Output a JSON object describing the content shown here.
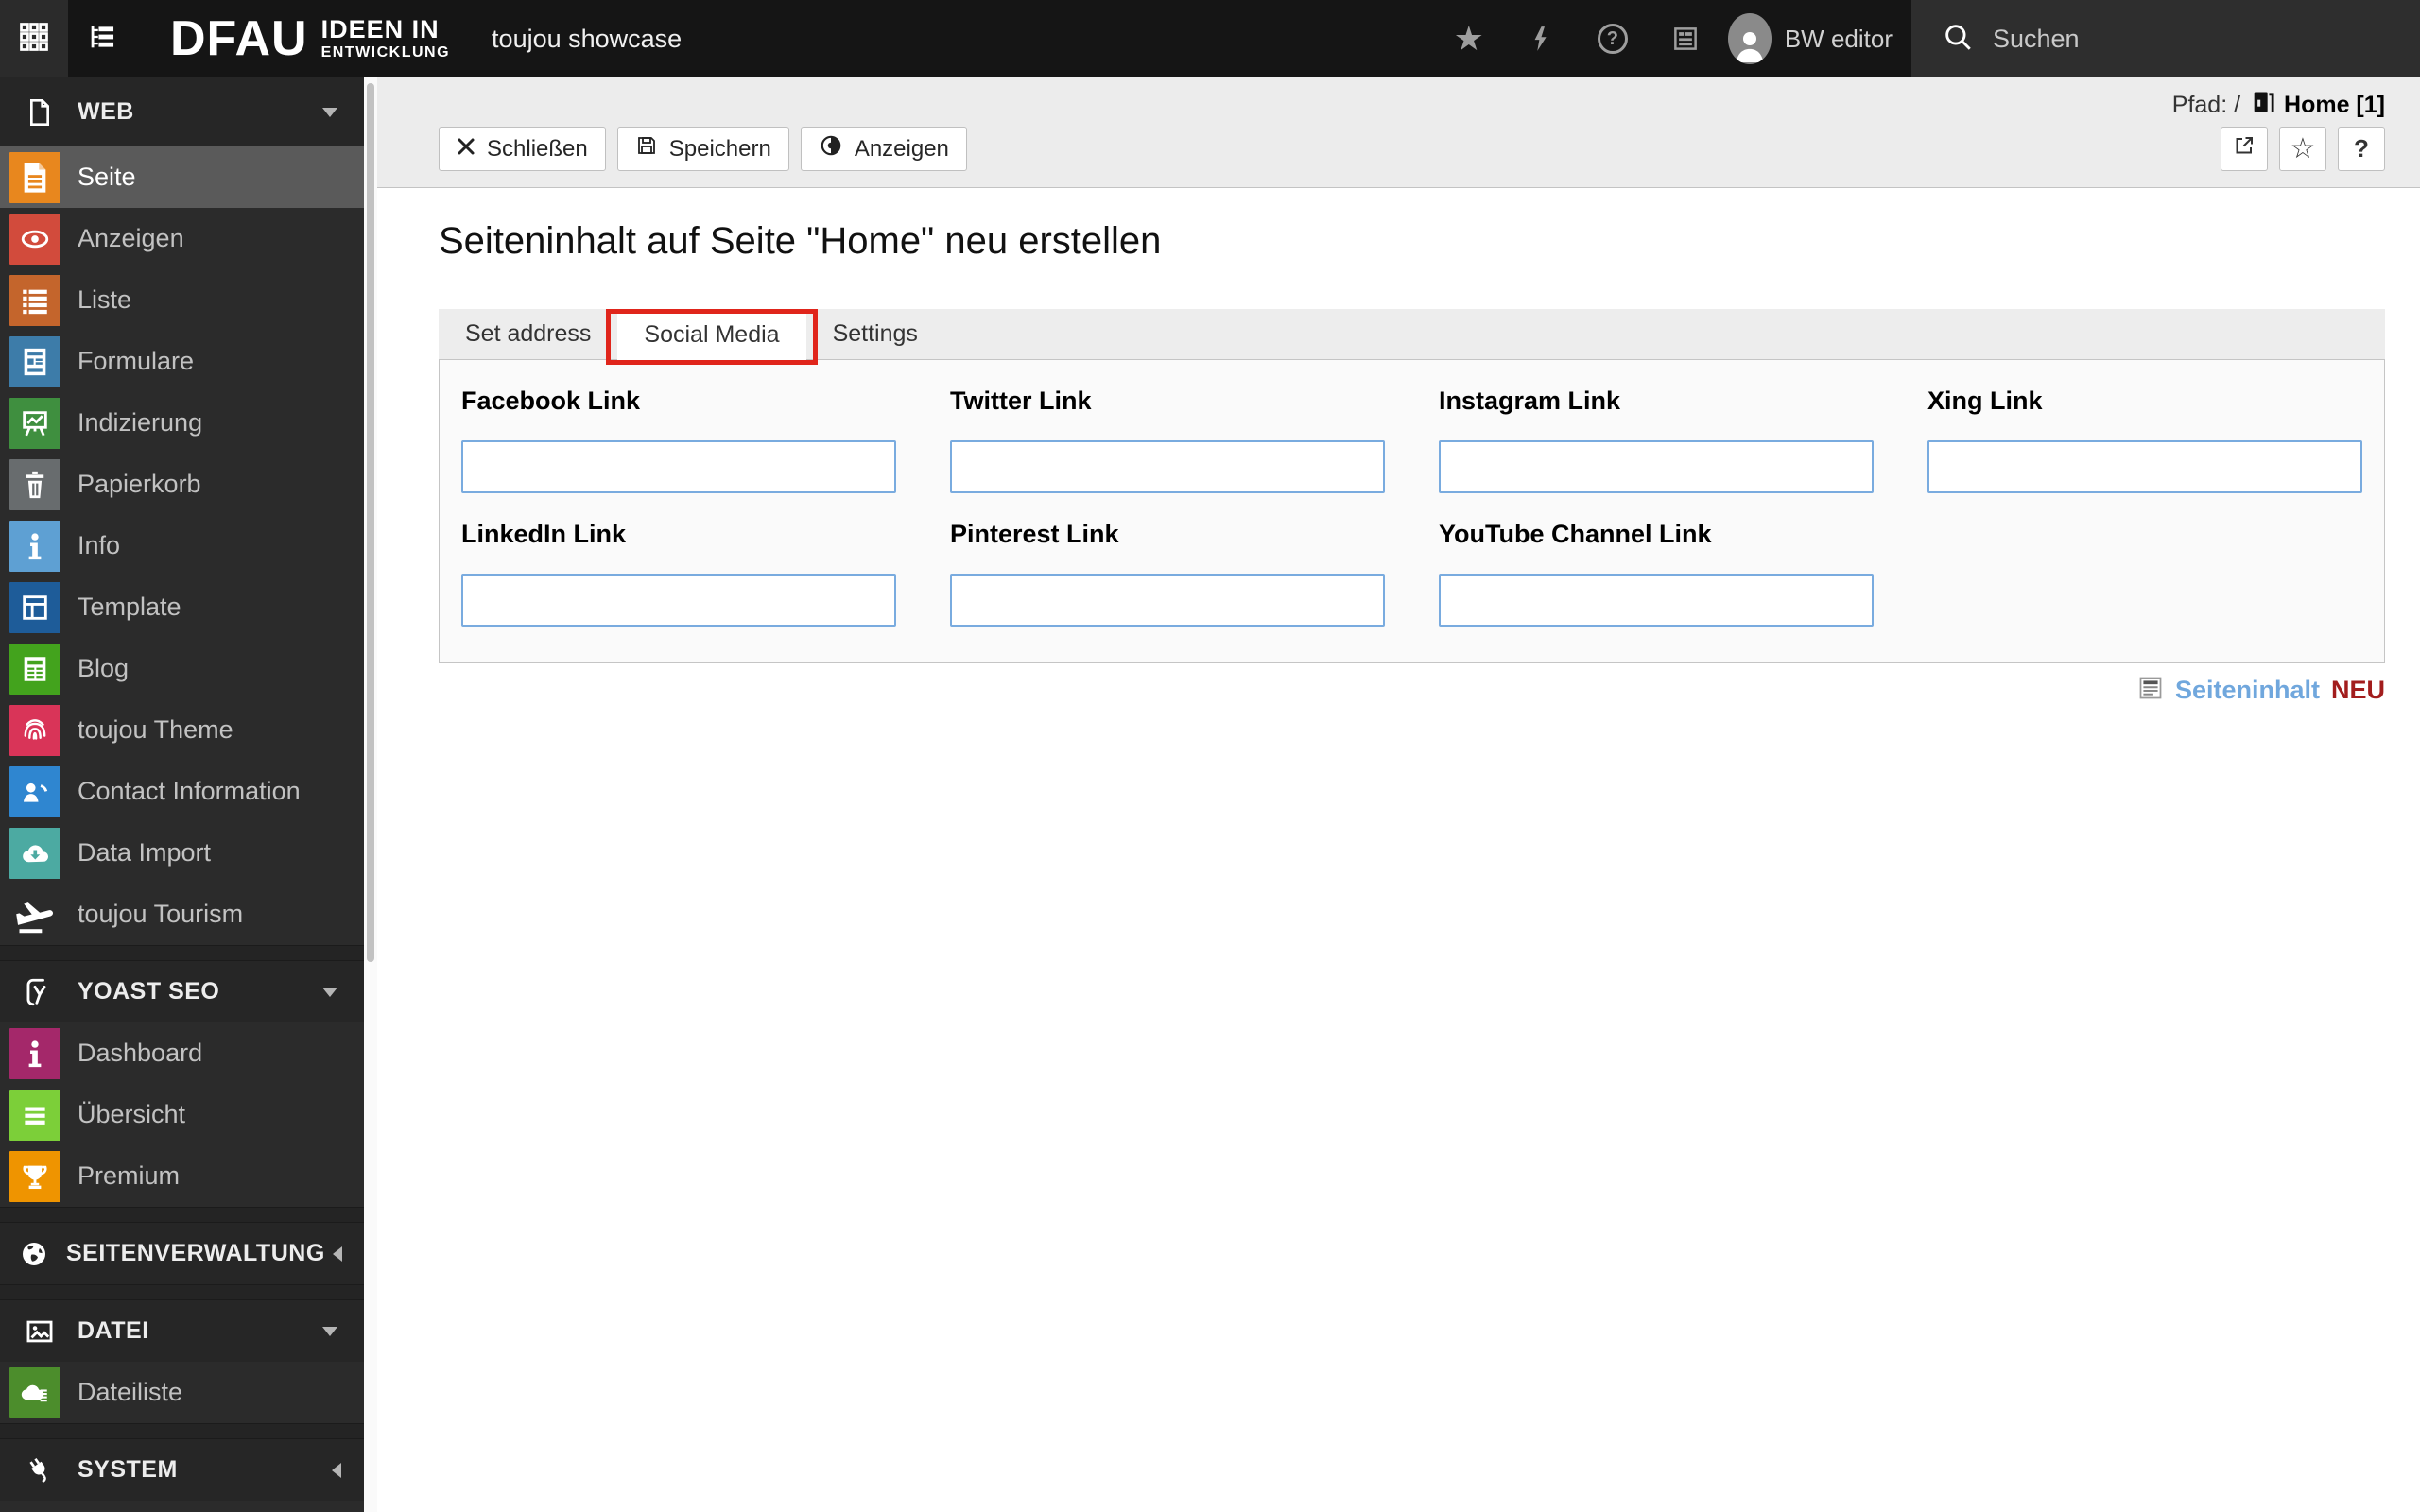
{
  "topbar": {
    "logo": {
      "brand": "DFAU",
      "claim_line1": "IDEEN IN",
      "claim_line2": "ENTWICKLUNG"
    },
    "product_title": "toujou showcase",
    "user_name": "BW editor",
    "search_placeholder": "Suchen",
    "icons": [
      "modules-grid-icon",
      "page-tree-icon",
      "bookmark-star-icon",
      "flush-cache-bolt-icon",
      "help-icon",
      "log-icon",
      "avatar",
      "search-icon"
    ]
  },
  "sidebar": {
    "sections": [
      {
        "label": "WEB",
        "icon": "document-outline-icon",
        "chevron": "down",
        "items": [
          {
            "label": "Seite",
            "icon": "page-icon",
            "tile_color": "#e8871e",
            "active": true
          },
          {
            "label": "Anzeigen",
            "icon": "eye-icon",
            "tile_color": "#d24b3c",
            "active": false
          },
          {
            "label": "Liste",
            "icon": "list-icon",
            "tile_color": "#c4652c",
            "active": false
          },
          {
            "label": "Formulare",
            "icon": "form-icon",
            "tile_color": "#3d7ca9",
            "active": false
          },
          {
            "label": "Indizierung",
            "icon": "chart-easel-icon",
            "tile_color": "#3f8f3f",
            "active": false
          },
          {
            "label": "Papierkorb",
            "icon": "trash-icon",
            "tile_color": "#686c6e",
            "active": false
          },
          {
            "label": "Info",
            "icon": "info-icon",
            "tile_color": "#5ea0d3",
            "active": false
          },
          {
            "label": "Template",
            "icon": "layout-icon",
            "tile_color": "#1e5c99",
            "active": false
          },
          {
            "label": "Blog",
            "icon": "newspaper-icon",
            "tile_color": "#43a31d",
            "active": false
          },
          {
            "label": "toujou Theme",
            "icon": "fingerprint-icon",
            "tile_color": "#d93458",
            "active": false
          },
          {
            "label": "Contact Information",
            "icon": "contact-phone-icon",
            "tile_color": "#2f86d0",
            "active": false
          },
          {
            "label": "Data Import",
            "icon": "cloud-download-icon",
            "tile_color": "#4caaa2",
            "active": false
          },
          {
            "label": "toujou Tourism",
            "icon": "plane-takeoff-icon",
            "tile_color": "transparent",
            "active": false
          }
        ]
      },
      {
        "label": "YOAST SEO",
        "icon": "yoast-icon",
        "chevron": "down",
        "items": [
          {
            "label": "Dashboard",
            "icon": "info-icon",
            "tile_color": "#a4286a",
            "active": false
          },
          {
            "label": "Übersicht",
            "icon": "hamburger-icon",
            "tile_color": "#7ccf39",
            "active": false
          },
          {
            "label": "Premium",
            "icon": "trophy-icon",
            "tile_color": "#ef9400",
            "active": false
          }
        ]
      },
      {
        "label": "SEITENVERWALTUNG",
        "icon": "globe-icon",
        "chevron": "left",
        "items": []
      },
      {
        "label": "DATEI",
        "icon": "image-icon",
        "chevron": "down",
        "items": [
          {
            "label": "Dateiliste",
            "icon": "cloud-list-icon",
            "tile_color": "#4c8d2c",
            "active": false
          }
        ]
      },
      {
        "label": "SYSTEM",
        "icon": "plug-icon",
        "chevron": "left",
        "items": []
      }
    ]
  },
  "docheader": {
    "path_prefix": "Pfad: /",
    "path_page": "Home [1]",
    "buttons": [
      {
        "label": "Schließen",
        "icon": "close-icon"
      },
      {
        "label": "Speichern",
        "icon": "save-icon"
      },
      {
        "label": "Anzeigen",
        "icon": "view-icon"
      }
    ],
    "icon_buttons": [
      {
        "name": "open-in-new-window",
        "icon": "external-link-icon"
      },
      {
        "name": "bookmark",
        "icon": "star-outline-icon",
        "glyph": "☆"
      },
      {
        "name": "help",
        "icon": "question-icon",
        "glyph": "?"
      }
    ]
  },
  "main": {
    "title": "Seiteninhalt auf Seite \"Home\" neu erstellen",
    "tabs": [
      {
        "label": "Set address",
        "active": false
      },
      {
        "label": "Social Media",
        "active": true,
        "annotated": true
      },
      {
        "label": "Settings",
        "active": false
      }
    ],
    "fields": [
      {
        "label": "Facebook Link",
        "value": ""
      },
      {
        "label": "Twitter Link",
        "value": ""
      },
      {
        "label": "Instagram Link",
        "value": ""
      },
      {
        "label": "Xing Link",
        "value": ""
      },
      {
        "label": "LinkedIn Link",
        "value": ""
      },
      {
        "label": "Pinterest Link",
        "value": ""
      },
      {
        "label": "YouTube Channel Link",
        "value": ""
      }
    ],
    "footer": {
      "link_label": "Seiteninhalt",
      "badge": "NEU"
    }
  },
  "colors": {
    "annotation_red": "#e0251b",
    "input_border_blue": "#79abdf",
    "footer_link_blue": "#70a7dd",
    "footer_badge_red": "#a21d1d",
    "topbar_bg": "#151515",
    "sidebar_bg": "#2b2b2b",
    "selected_row_bg": "#5a5a5a",
    "docheader_bg": "#ececec"
  }
}
